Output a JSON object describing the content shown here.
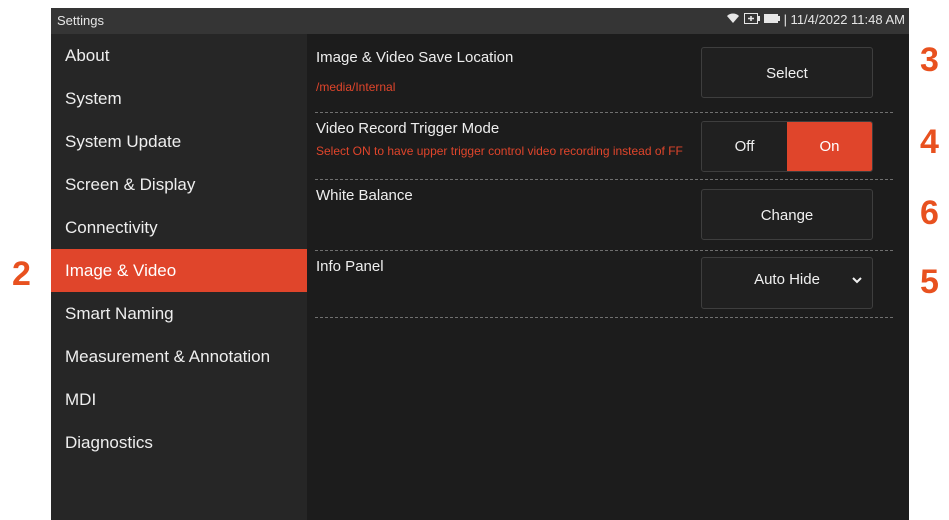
{
  "callouts": {
    "c2": "2",
    "c3": "3",
    "c4": "4",
    "c5": "5",
    "c6": "6"
  },
  "statusbar": {
    "title": "Settings",
    "datetime": "| 11/4/2022 11:48 AM",
    "icons": [
      "wifi-icon",
      "battery-plug-icon",
      "battery-icon"
    ]
  },
  "sidebar": {
    "items": [
      {
        "label": "About"
      },
      {
        "label": "System"
      },
      {
        "label": "System Update"
      },
      {
        "label": "Screen & Display"
      },
      {
        "label": "Connectivity"
      },
      {
        "label": "Image & Video",
        "active": true
      },
      {
        "label": "Smart Naming"
      },
      {
        "label": "Measurement & Annotation"
      },
      {
        "label": "MDI"
      },
      {
        "label": "Diagnostics"
      }
    ]
  },
  "settings": {
    "save_location": {
      "label": "Image & Video Save Location",
      "value": "/media/Internal",
      "button": "Select"
    },
    "trigger_mode": {
      "label": "Video Record Trigger Mode",
      "description": "Select ON to have upper trigger control video recording instead of FF",
      "off": "Off",
      "on": "On",
      "selected": "On"
    },
    "white_balance": {
      "label": "White Balance",
      "button": "Change"
    },
    "info_panel": {
      "label": "Info Panel",
      "value": "Auto Hide"
    }
  },
  "colors": {
    "accent": "#e0452b",
    "callout": "#e8511f",
    "background": "#1c1c1c",
    "sidebar": "#262626"
  }
}
